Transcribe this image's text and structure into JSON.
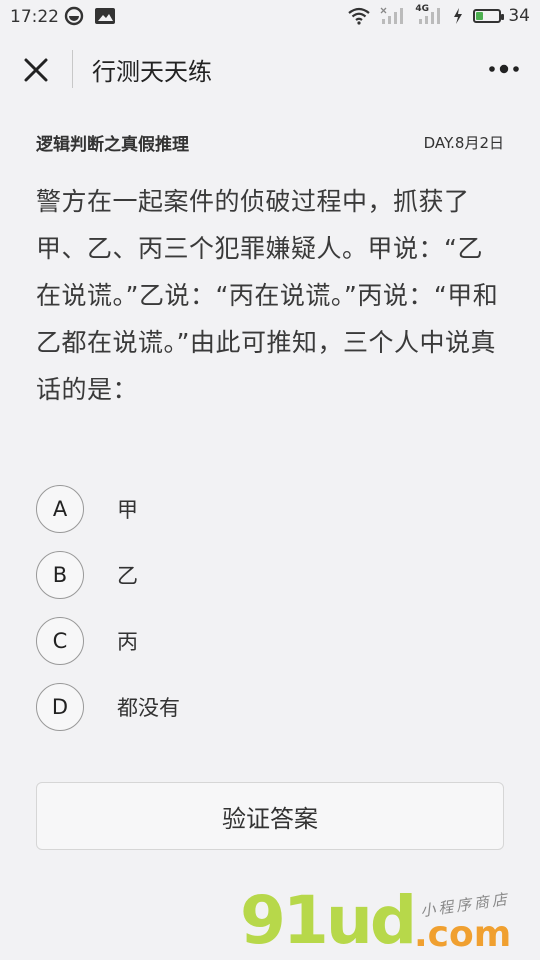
{
  "status_bar": {
    "time": "17:22",
    "network_label": "4G",
    "battery_level": "34",
    "battery_fraction": 0.34
  },
  "nav": {
    "title": "行测天天练",
    "close_icon": "close-icon",
    "more_icon": "more-icon"
  },
  "question": {
    "category": "逻辑判断之真假推理",
    "date": "DAY.8月2日",
    "text": "警方在一起案件的侦破过程中，抓获了甲、乙、丙三个犯罪嫌疑人。甲说：“乙在说谎。”乙说：“丙在说谎。”丙说：“甲和乙都在说谎。”由此可推知，三个人中说真话的是："
  },
  "options": [
    {
      "letter": "A",
      "text": "甲"
    },
    {
      "letter": "B",
      "text": "乙"
    },
    {
      "letter": "C",
      "text": "丙"
    },
    {
      "letter": "D",
      "text": "都没有"
    }
  ],
  "verify_button": {
    "label": "验证答案"
  },
  "watermark": {
    "main": "91ud",
    "suffix": ".com",
    "tagline": "小程序商店"
  },
  "colors": {
    "background": "#f2f2f4",
    "battery_fill": "#4caf50",
    "watermark_green": "#b7d84a",
    "watermark_orange": "#f0a030"
  }
}
